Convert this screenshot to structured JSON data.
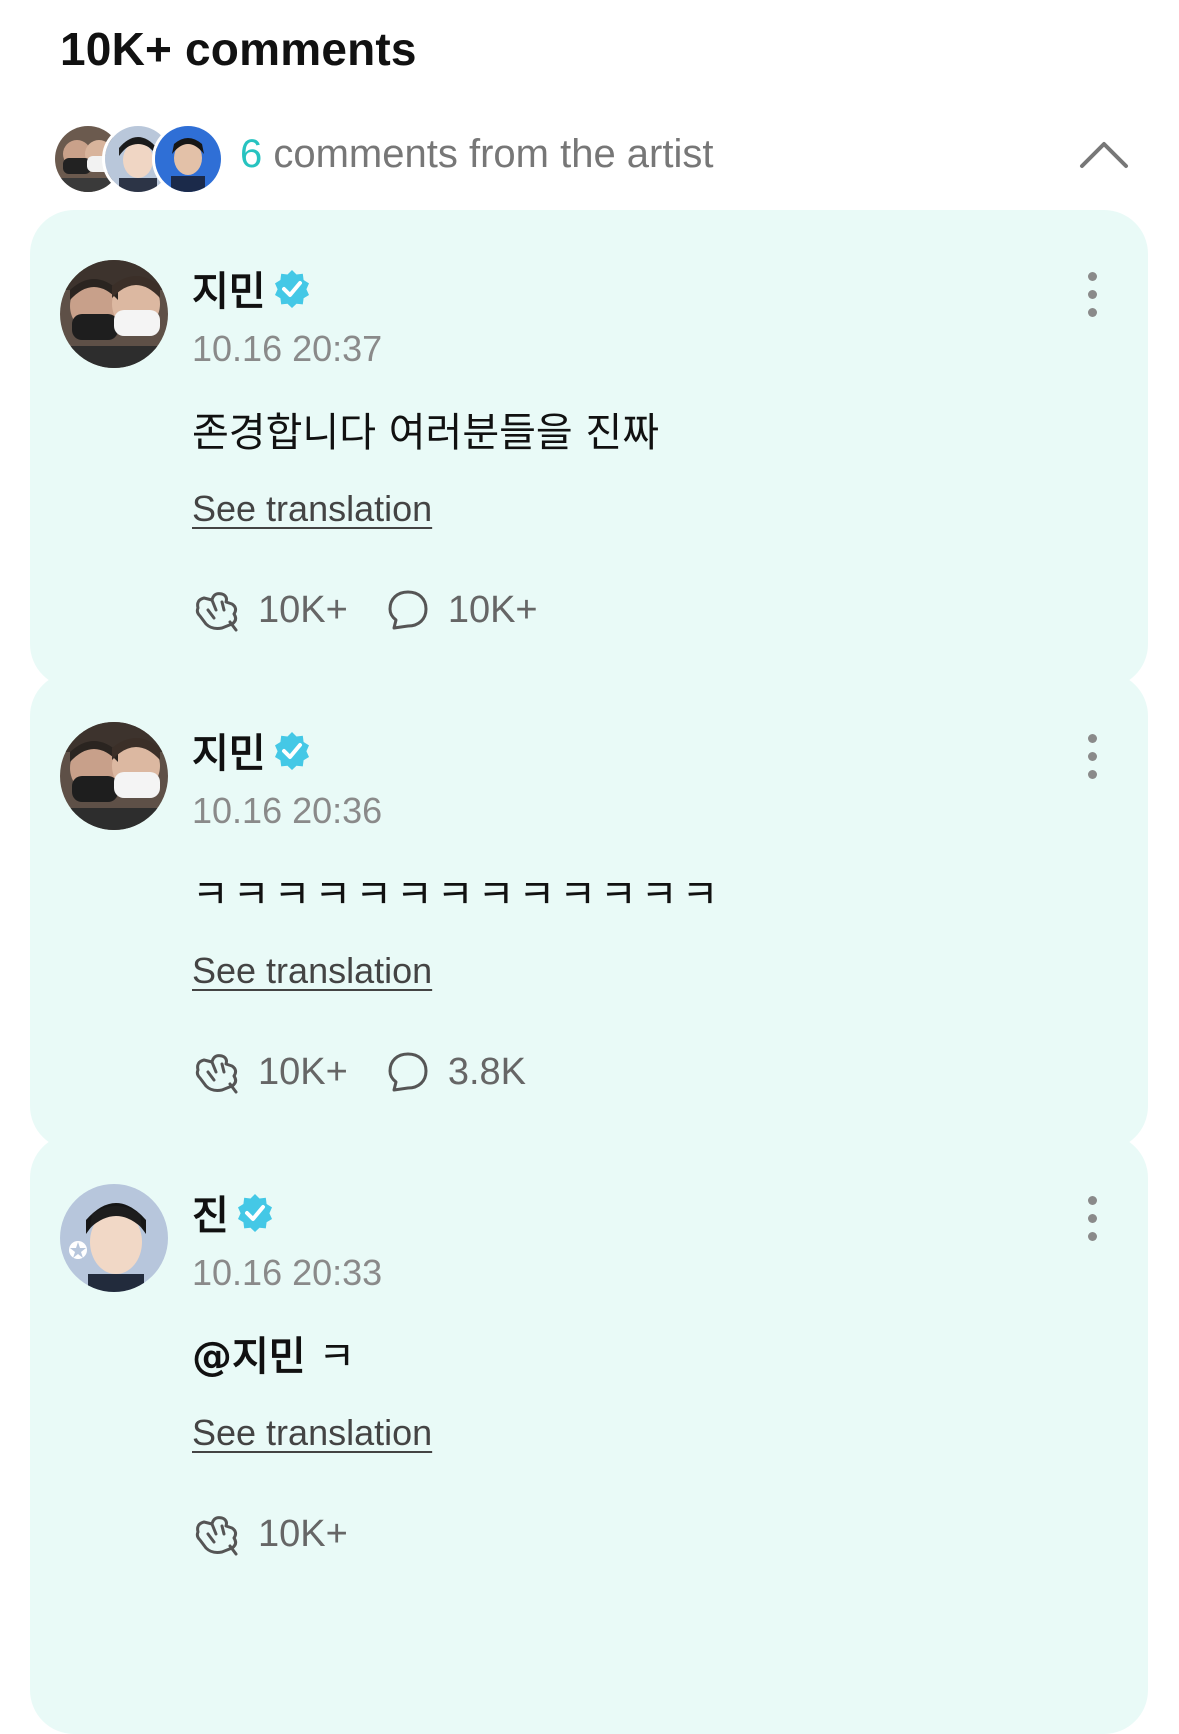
{
  "header": {
    "title": "10K+ comments"
  },
  "artist_summary": {
    "count": "6",
    "text": " comments from the artist",
    "collapse_icon": "chevron-up-icon"
  },
  "colors": {
    "accent": "#27c3c0",
    "card_background": "#e9faf7",
    "verified_badge": "#44c8e6"
  },
  "comments": [
    {
      "author": "지민",
      "verified": true,
      "timestamp": "10.16 20:37",
      "text": "존경합니다 여러분들을 진짜",
      "see_translation": "See translation",
      "likes": "10K+",
      "replies": "10K+"
    },
    {
      "author": "지민",
      "verified": true,
      "timestamp": "10.16 20:36",
      "text": "ㅋㅋㅋㅋㅋㅋㅋㅋㅋㅋㅋㅋㅋ",
      "see_translation": "See translation",
      "likes": "10K+",
      "replies": "3.8K"
    },
    {
      "author": "진",
      "verified": true,
      "timestamp": "10.16 20:33",
      "mention": "@지민",
      "text": " ㅋ",
      "see_translation": "See translation",
      "likes": "10K+"
    }
  ]
}
